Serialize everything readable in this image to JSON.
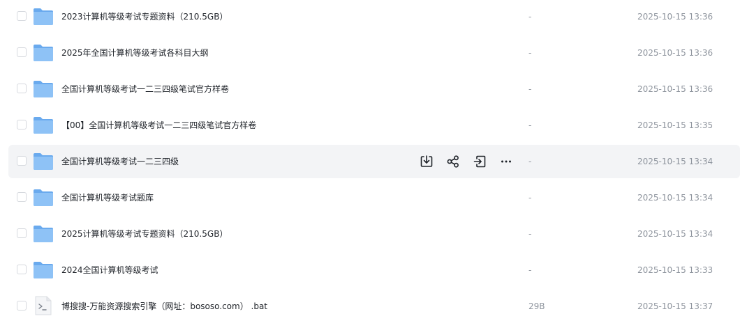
{
  "rows": [
    {
      "name": "2023计算机等级考试专题资料（210.5GB）",
      "size": "-",
      "date": "2025-10-15 13:36",
      "type": "folder"
    },
    {
      "name": "2025年全国计算机等级考试各科目大纲",
      "size": "-",
      "date": "2025-10-15 13:36",
      "type": "folder"
    },
    {
      "name": "全国计算机等级考试一二三四级笔试官方样卷",
      "size": "-",
      "date": "2025-10-15 13:36",
      "type": "folder"
    },
    {
      "name": "【00】全国计算机等级考试一二三四级笔试官方样卷",
      "size": "-",
      "date": "2025-10-15 13:35",
      "type": "folder"
    },
    {
      "name": "全国计算机等级考试一二三四级",
      "size": "-",
      "date": "2025-10-15 13:34",
      "type": "folder"
    },
    {
      "name": "全国计算机等级考试题库",
      "size": "-",
      "date": "2025-10-15 13:34",
      "type": "folder"
    },
    {
      "name": "2025计算机等级考试专题资料（210.5GB）",
      "size": "-",
      "date": "2025-10-15 13:34",
      "type": "folder"
    },
    {
      "name": "2024全国计算机等级考试",
      "size": "-",
      "date": "2025-10-15 13:33",
      "type": "folder"
    },
    {
      "name": "博搜搜-万能资源搜索引擎（网址：bososo.com）  .bat",
      "size": "29B",
      "date": "2025-10-15 13:37",
      "type": "bat"
    }
  ],
  "hover_actions": [
    "download-icon",
    "share-icon",
    "move-icon",
    "more-icon"
  ],
  "colors": {
    "folder": "#7cb7f2",
    "hover_bg": "#f3f4f6",
    "muted_text": "#8f959e"
  }
}
